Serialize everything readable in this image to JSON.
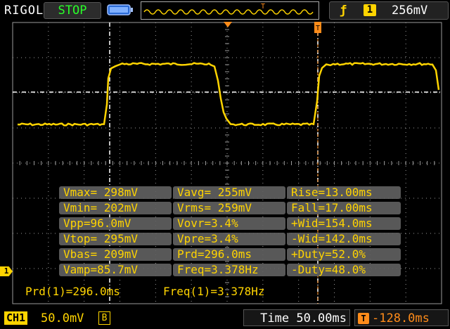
{
  "header": {
    "brand": "RIGOL",
    "run_status": "STOP",
    "trigger_channel": "1",
    "trigger_level": "256mV"
  },
  "measurements": {
    "col1": [
      "Vmax= 298mV",
      "Vmin= 202mV",
      "Vpp=96.0mV",
      "Vtop= 295mV",
      "Vbas= 209mV",
      "Vamp=85.7mV"
    ],
    "col2": [
      "Vavg= 255mV",
      "Vrms= 259mV",
      "Vovr=3.4%",
      "Vpre=3.4%",
      "Prd=296.0ms",
      "Freq=3.378Hz"
    ],
    "col3": [
      "Rise=13.00ms",
      "Fall=17.00ms",
      "+Wid=154.0ms",
      "-Wid=142.0ms",
      "+Duty=52.0%",
      "-Duty=48.0%"
    ]
  },
  "bottom_readout": {
    "period": "Prd(1)=296.0ms",
    "frequency": "Freq(1)=3.378Hz"
  },
  "footer": {
    "channel": "CH1",
    "scale": "50.0mV",
    "bw_limit": "B",
    "timebase": "Time 50.00ms",
    "trigger_offset": "-128.0ms"
  },
  "channel_marker": "1",
  "colors": {
    "trace": "#ffd400",
    "status_stop": "#29ff29",
    "offset": "#ff8c1a",
    "grid": "#9a9a9a"
  }
}
